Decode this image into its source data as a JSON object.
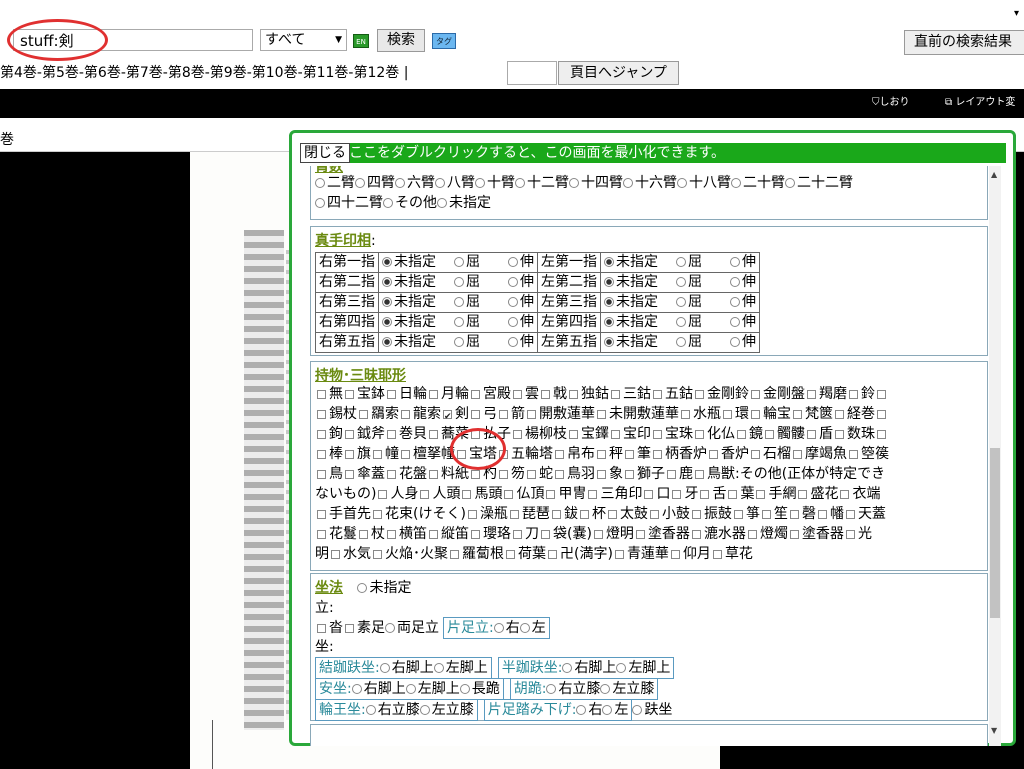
{
  "search": {
    "value": "stuff:剣"
  },
  "scope": {
    "value": "すべて"
  },
  "buttons": {
    "en": "EN",
    "search": "検索",
    "tag": "タグ",
    "prev_results": "直前の検索結果",
    "jump": "頁目へジャンプ"
  },
  "volumes_nav": "第4巻-第5巻-第6巻-第7巻-第8巻-第9巻-第10巻-第11巻-第12巻 |",
  "toolbar": {
    "bookmark": "しおり",
    "layout": "レイアウト変"
  },
  "viewer": {
    "volume_label": "巻"
  },
  "dialog": {
    "close": "閉じる",
    "header_text": "ここをダブルクリックすると、この画面を最小化できます。",
    "arms": {
      "title_fragment": "臂数",
      "row1": [
        "二臂",
        "四臂",
        "六臂",
        "八臂",
        "十臂",
        "十二臂",
        "十四臂",
        "十六臂",
        "十八臂",
        "二十臂",
        "二十二臂"
      ],
      "row2": [
        "四十二臂",
        "その他",
        "未指定"
      ]
    },
    "mudra": {
      "title": "真手印相",
      "colon": ":",
      "rows": [
        {
          "right": "右第一指",
          "left": "左第一指"
        },
        {
          "right": "右第二指",
          "left": "左第二指"
        },
        {
          "right": "右第三指",
          "left": "左第三指"
        },
        {
          "right": "右第四指",
          "left": "左第四指"
        },
        {
          "right": "右第五指",
          "left": "左第五指"
        }
      ],
      "opt_unspecified": "未指定",
      "opt_bend": "屈",
      "opt_extend": "伸"
    },
    "attributes": {
      "title": "持物･三昧耶形",
      "rows": [
        [
          "無",
          "宝鉢",
          "日輪",
          "月輪",
          "宮殿",
          "雲",
          "戟",
          "独鈷",
          "三鈷",
          "五鈷",
          "金剛鈴",
          "金剛盤",
          "羯磨",
          "鈴",
          ""
        ],
        [
          "錫杖",
          "羂索",
          "龍索",
          "剣",
          "弓",
          "箭",
          "開敷蓮華",
          "未開敷蓮華",
          "水瓶",
          "環",
          "輪宝",
          "梵篋",
          "経巻",
          ""
        ],
        [
          "鉤",
          "鉞斧",
          "巻貝",
          "蕎菜",
          "払子",
          "楊柳枝",
          "宝鐸",
          "宝印",
          "宝珠",
          "化仏",
          "鏡",
          "髑髏",
          "盾",
          "数珠",
          ""
        ],
        [
          "棒",
          "旗",
          "幢",
          "檀拏幢",
          "宝塔",
          "五輪塔",
          "帛布",
          "秤",
          "筆",
          "柄香炉",
          "香炉",
          "石榴",
          "摩竭魚",
          "箜篌"
        ],
        [
          "鳥",
          "傘蓋",
          "花盤",
          "料紙",
          "杓",
          "笏",
          "蛇",
          "鳥羽",
          "象",
          "獅子",
          "鹿",
          "鳥獣:その他(正体が特定でき"
        ],
        [
          "ないもの)",
          "人身",
          "人頭",
          "馬頭",
          "仏頂",
          "甲冑",
          "三角印",
          "口",
          "牙",
          "舌",
          "葉",
          "手網",
          "盛花",
          "衣端"
        ],
        [
          "手首先",
          "花束(けそく)",
          "澡瓶",
          "琵琶",
          "鈸",
          "杯",
          "太鼓",
          "小鼓",
          "振鼓",
          "箏",
          "笙",
          "磬",
          "幡",
          "天蓋"
        ],
        [
          "花鬘",
          "杖",
          "横笛",
          "縦笛",
          "瓔珞",
          "刀",
          "袋(嚢)",
          "燈明",
          "塗香器",
          "漉水器",
          "燈燭",
          "塗香器",
          "光"
        ],
        [
          "明",
          "水気",
          "火焔･火聚",
          "羅蔔根",
          "荷葉",
          "卍(満字)",
          "青蓮華",
          "仰月",
          "草花"
        ]
      ]
    },
    "posture": {
      "title": "坐法",
      "unspecified": "未指定",
      "standing": "立:",
      "standing_opts": [
        "沓",
        "素足",
        "両足立"
      ],
      "one_leg": {
        "label": "片足立:",
        "opts": [
          "右",
          "左"
        ]
      },
      "seated": "坐:",
      "lotus": {
        "label": "結跏趺坐:",
        "opts": [
          "右脚上",
          "左脚上"
        ]
      },
      "half_lotus": {
        "label": "半跏趺坐:",
        "opts": [
          "右脚上",
          "左脚上"
        ]
      },
      "ease": {
        "label": "安坐:",
        "opts": [
          "右脚上",
          "左脚上",
          "長跪"
        ]
      },
      "kneel": {
        "label": "胡跪:",
        "opts": [
          "右立膝",
          "左立膝"
        ]
      },
      "royal": {
        "label": "輪王坐:",
        "opts": [
          "右立膝",
          "左立膝"
        ]
      },
      "pendant": {
        "label": "片足踏み下げ:",
        "opts": [
          "右",
          "左"
        ]
      },
      "crosslegged": "趺坐"
    }
  }
}
